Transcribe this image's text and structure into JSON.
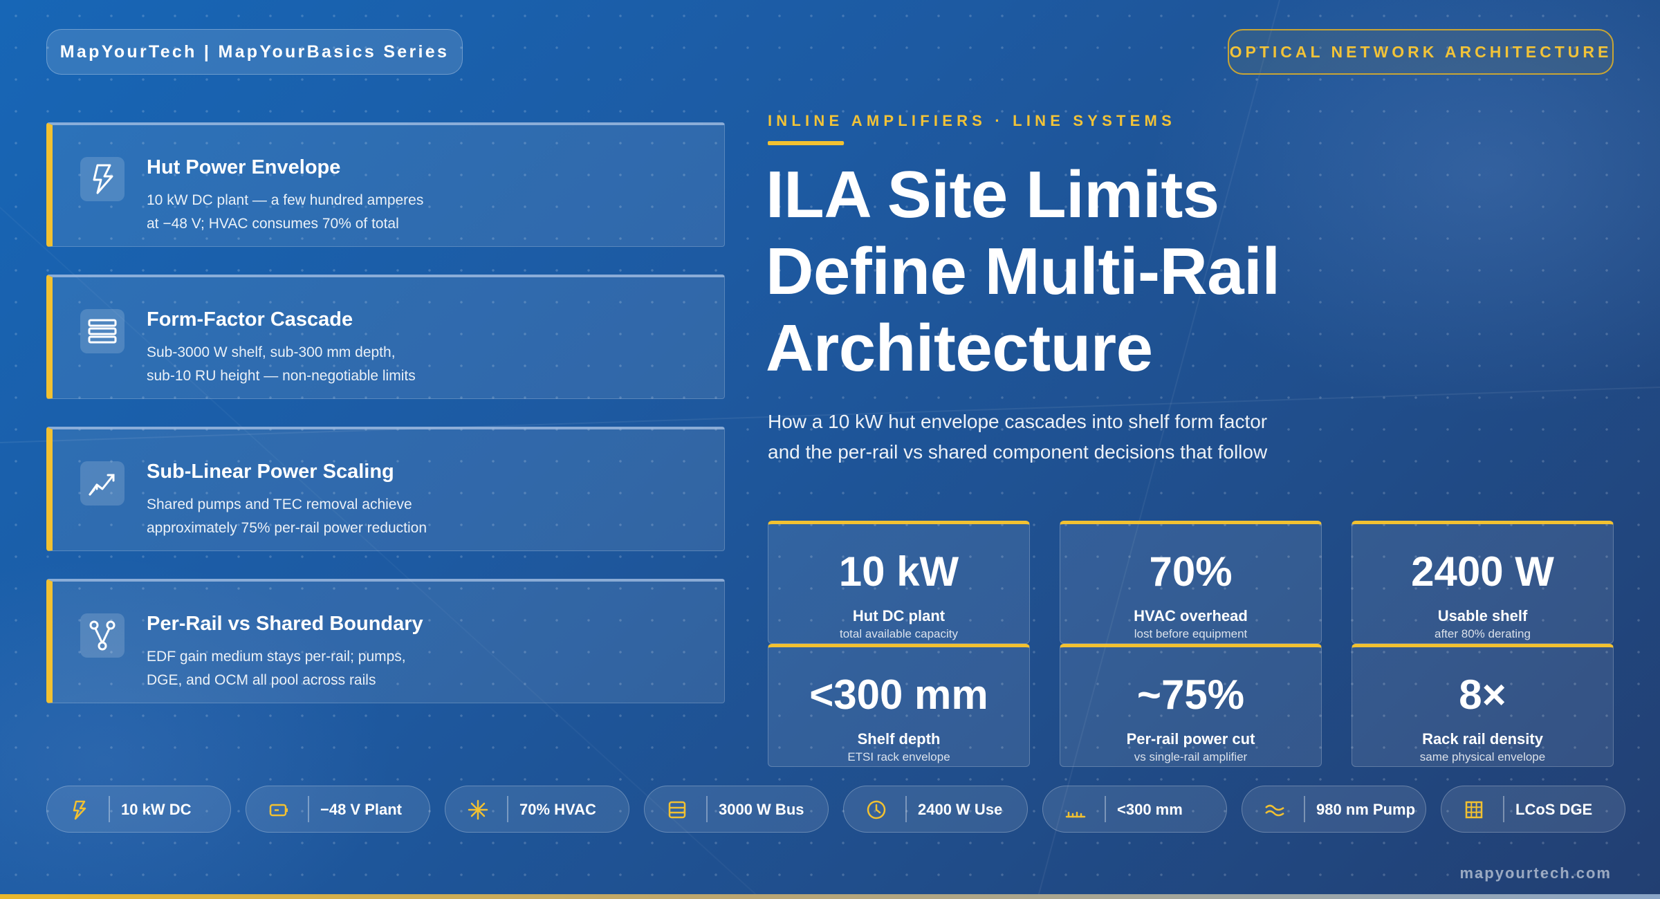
{
  "header": {
    "brand": "MapYourTech | MapYourBasics Series",
    "topic": "OPTICAL NETWORK ARCHITECTURE"
  },
  "cards": [
    {
      "icon": "lightning-bolt-icon",
      "title": "Hut Power Envelope",
      "desc_line1": "10 kW DC plant — a few hundred amperes",
      "desc_line2": "at −48 V; HVAC consumes 70% of total"
    },
    {
      "icon": "stacked-layers-icon",
      "title": "Form-Factor Cascade",
      "desc_line1": "Sub-3000 W shelf, sub-300 mm depth,",
      "desc_line2": "sub-10 RU height — non-negotiable limits"
    },
    {
      "icon": "trend-line-icon",
      "title": "Sub-Linear Power Scaling",
      "desc_line1": "Shared pumps and TEC removal achieve",
      "desc_line2": "approximately 75% per-rail power reduction"
    },
    {
      "icon": "branch-fork-icon",
      "title": "Per-Rail vs Shared Boundary",
      "desc_line1": "EDF gain medium stays per-rail; pumps,",
      "desc_line2": "DGE, and OCM all pool across rails"
    }
  ],
  "hero": {
    "eyebrow": "INLINE AMPLIFIERS · LINE SYSTEMS",
    "title_line1": "ILA Site Limits",
    "title_line2": "Define Multi-Rail",
    "title_line3": "Architecture",
    "subtitle_line1": "How a 10 kW hut envelope cascades into shelf form factor",
    "subtitle_line2": "and the per-rail vs shared component decisions that follow"
  },
  "stats": [
    {
      "value": "10 kW",
      "label": "Hut DC plant",
      "sub": "total available capacity"
    },
    {
      "value": "70%",
      "label": "HVAC overhead",
      "sub": "lost before equipment"
    },
    {
      "value": "2400 W",
      "label": "Usable shelf",
      "sub": "after 80% derating"
    },
    {
      "value": "<300 mm",
      "label": "Shelf depth",
      "sub": "ETSI rack envelope"
    },
    {
      "value": "~75%",
      "label": "Per-rail power cut",
      "sub": "vs single-rail amplifier"
    },
    {
      "value": "8×",
      "label": "Rack rail density",
      "sub": "same physical envelope"
    }
  ],
  "chips": [
    {
      "icon": "bolt-icon",
      "label": "10 kW DC"
    },
    {
      "icon": "battery-icon",
      "label": "−48 V Plant"
    },
    {
      "icon": "snowflake-icon",
      "label": "70% HVAC"
    },
    {
      "icon": "bus-bar-icon",
      "label": "3000 W Bus"
    },
    {
      "icon": "gauge-icon",
      "label": "2400 W Use"
    },
    {
      "icon": "ruler-icon",
      "label": "<300 mm"
    },
    {
      "icon": "wave-icon",
      "label": "980 nm Pump"
    },
    {
      "icon": "grid-icon",
      "label": "LCoS DGE"
    }
  ],
  "footer": {
    "url": "mapyourtech.com"
  },
  "colors": {
    "accent": "#f2c131",
    "background_top": "#1766b6",
    "background_bottom": "#223f72"
  }
}
